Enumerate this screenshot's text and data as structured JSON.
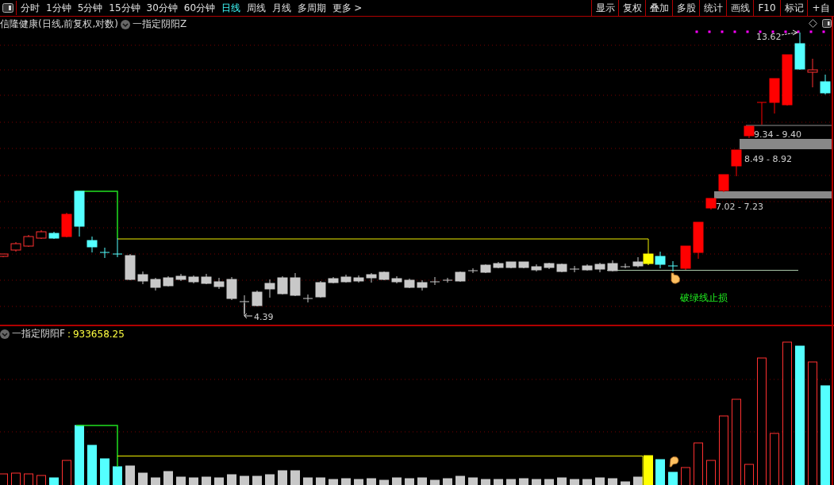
{
  "toolbar": {
    "periods": [
      {
        "label": "分时",
        "selected": false
      },
      {
        "label": "1分钟",
        "selected": false
      },
      {
        "label": "5分钟",
        "selected": false
      },
      {
        "label": "15分钟",
        "selected": false
      },
      {
        "label": "30分钟",
        "selected": false
      },
      {
        "label": "60分钟",
        "selected": false
      },
      {
        "label": "日线",
        "selected": true
      },
      {
        "label": "周线",
        "selected": false
      },
      {
        "label": "月线",
        "selected": false
      },
      {
        "label": "多周期",
        "selected": false
      },
      {
        "label": "更多",
        "selected": false
      }
    ],
    "more_arrow": ">",
    "tools": [
      "显示",
      "复权",
      "叠加",
      "多股",
      "统计",
      "画线",
      "F10",
      "标记",
      "+自"
    ]
  },
  "main_chart": {
    "title": "信隆健康(日线,前复权,对数)",
    "indicator": "一指定阴阳Z",
    "high_label": "13.62",
    "low_label": "4.39",
    "zone_labels": [
      "9.34 - 9.40",
      "8.49 - 8.92",
      "7.02 - 7.23"
    ],
    "note": "破绿线止损"
  },
  "sub_chart": {
    "indicator": "一指定阴阳F",
    "separator": ":",
    "value": "933658.25"
  }
}
